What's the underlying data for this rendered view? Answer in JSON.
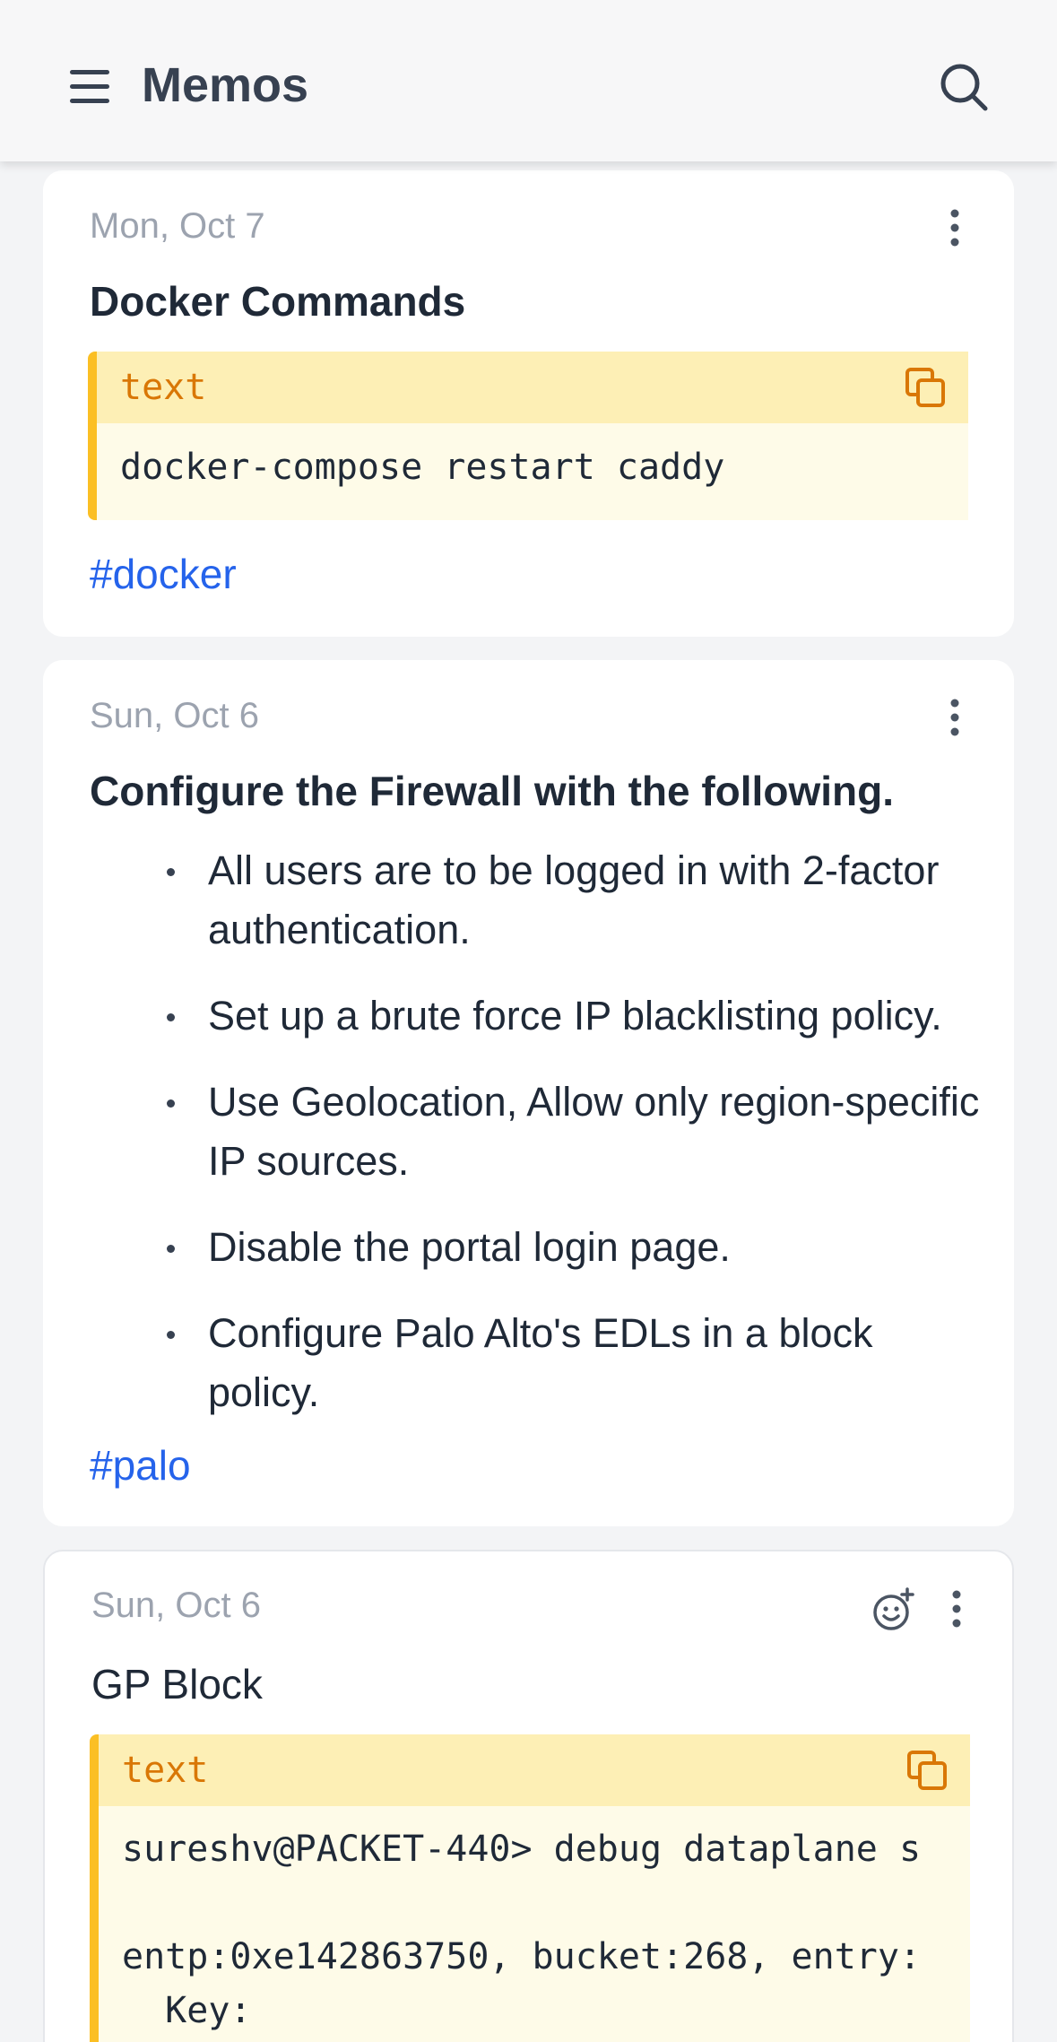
{
  "header": {
    "title": "Memos",
    "menu_icon": "hamburger-menu-icon",
    "search_icon": "search-icon"
  },
  "colors": {
    "accent": "#fbbf24",
    "code_header_bg": "#fdefb5",
    "code_body_bg": "#fefbe8",
    "tag": "#2563eb",
    "lang_label": "#d97706",
    "date": "#9ca3af"
  },
  "memos": [
    {
      "date": "Mon, Oct 7",
      "title": "Docker Commands",
      "code": {
        "language": "text",
        "content": "docker-compose restart caddy"
      },
      "tag": "#docker"
    },
    {
      "date": "Sun, Oct 6",
      "title": "Configure the Firewall with the following.",
      "items": [
        "All users are to be logged in with 2-factor authentication.",
        "Set up a brute force IP blacklisting policy.",
        "Use Geolocation, Allow only region-specific IP sources.",
        "Disable the portal login page.",
        "Configure Palo Alto's EDLs in a block policy."
      ],
      "tag": "#palo"
    },
    {
      "date": "Sun, Oct 6",
      "title": "GP Block",
      "code": {
        "language": "text",
        "content": "sureshv@PACKET-440> debug dataplane s\n\nentp:0xe142863750, bucket:268, entry:\n  Key:"
      }
    }
  ]
}
